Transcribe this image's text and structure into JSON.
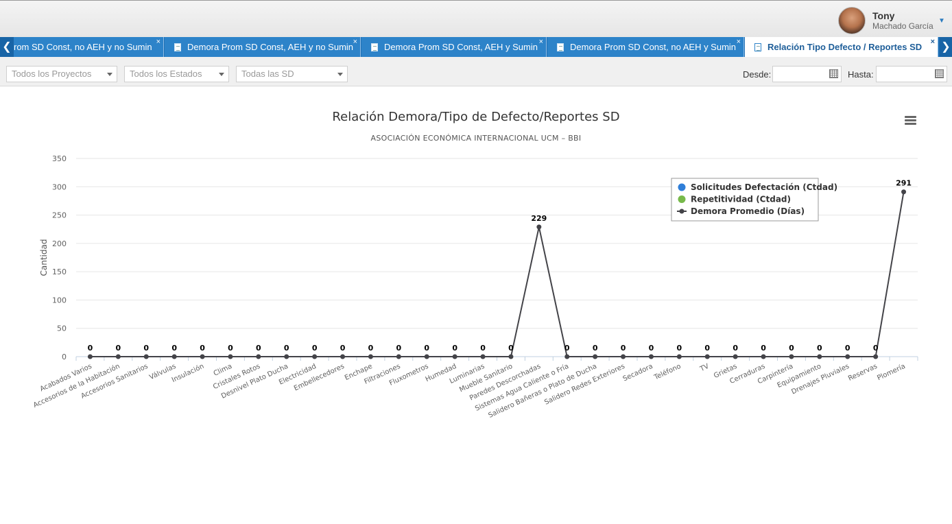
{
  "user": {
    "name": "Tony",
    "surname": "Machado García"
  },
  "tabs": [
    {
      "label": "rom SD Const, no AEH y no Sumin",
      "active": false,
      "icon": false
    },
    {
      "label": "Demora Prom SD Const, AEH y no Sumin",
      "active": false,
      "icon": true
    },
    {
      "label": "Demora Prom SD Const, AEH y Sumin",
      "active": false,
      "icon": true
    },
    {
      "label": "Demora Prom SD Const, no AEH y Sumin",
      "active": false,
      "icon": true
    },
    {
      "label": "Relación Tipo Defecto / Reportes SD",
      "active": true,
      "icon": true
    }
  ],
  "tab_close": "×",
  "tab_scroll_left": "❮",
  "tab_scroll_right": "❯",
  "filters": {
    "projects": "Todos los Proyectos",
    "states": "Todos los Estados",
    "sd": "Todas las SD",
    "from_label": "Desde:",
    "to_label": "Hasta:"
  },
  "chart_data": {
    "type": "line",
    "title": "Relación Demora/Tipo de Defecto/Reportes SD",
    "subtitle": "ASOCIACIÓN ECONÓMICA INTERNACIONAL UCM – BBI",
    "ylabel": "Cantidad",
    "ylim": [
      0,
      350
    ],
    "yticks": [
      0,
      50,
      100,
      150,
      200,
      250,
      300,
      350
    ],
    "grid": true,
    "legend_position": "top-right",
    "categories": [
      "Acabados Varios",
      "Accesorios de la Habitación",
      "Accesorios Sanitarios",
      "Válvulas",
      "Insulación",
      "Clima",
      "Cristales Rotos",
      "Desnivel Plato Ducha",
      "Electricidad",
      "Embellecedores",
      "Enchape",
      "Filtraciones",
      "Fluxometros",
      "Humedad",
      "Luminarias",
      "Mueble Sanitario",
      "Paredes Descorchadas",
      "Sistemas Agua Caliente o Fría",
      "Salidero Bañeras o Plato de Ducha",
      "Salidero Redes Exteriores",
      "Secadora",
      "Teléfono",
      "TV",
      "Grietas",
      "Cerraduras",
      "Carpintería",
      "Equipamiento",
      "Drenajes Pluviales",
      "Reservas",
      "Plomería"
    ],
    "series": [
      {
        "name": "Solicitudes Defectación (Ctdad)",
        "kind": "bar",
        "color": "#2f7ed8",
        "values": [
          0,
          0,
          0,
          0,
          0,
          0,
          0,
          0,
          0,
          0,
          0,
          0,
          0,
          0,
          0,
          0,
          0,
          0,
          0,
          0,
          0,
          0,
          0,
          0,
          0,
          0,
          0,
          0,
          0,
          0
        ]
      },
      {
        "name": "Repetitividad (Ctdad)",
        "kind": "bar",
        "color": "#77b94a",
        "values": [
          0,
          0,
          0,
          0,
          0,
          0,
          0,
          0,
          0,
          0,
          0,
          0,
          0,
          0,
          0,
          0,
          0,
          0,
          0,
          0,
          0,
          0,
          0,
          0,
          0,
          0,
          0,
          0,
          0,
          0
        ]
      },
      {
        "name": "Demora Promedio (Días)",
        "kind": "line",
        "color": "#434348",
        "values": [
          0,
          0,
          0,
          0,
          0,
          0,
          0,
          0,
          0,
          0,
          0,
          0,
          0,
          0,
          0,
          0,
          229,
          0,
          0,
          0,
          0,
          0,
          0,
          0,
          0,
          0,
          0,
          0,
          0,
          291
        ],
        "data_labels": [
          "0",
          "0",
          "0",
          "0",
          "0",
          "0",
          "0",
          "0",
          "0",
          "0",
          "0",
          "0",
          "0",
          "0",
          "0",
          "0",
          "229",
          "0",
          "0",
          "0",
          "0",
          "0",
          "0",
          "0",
          "0",
          "0",
          "0",
          "0",
          "0",
          "291"
        ]
      }
    ]
  }
}
